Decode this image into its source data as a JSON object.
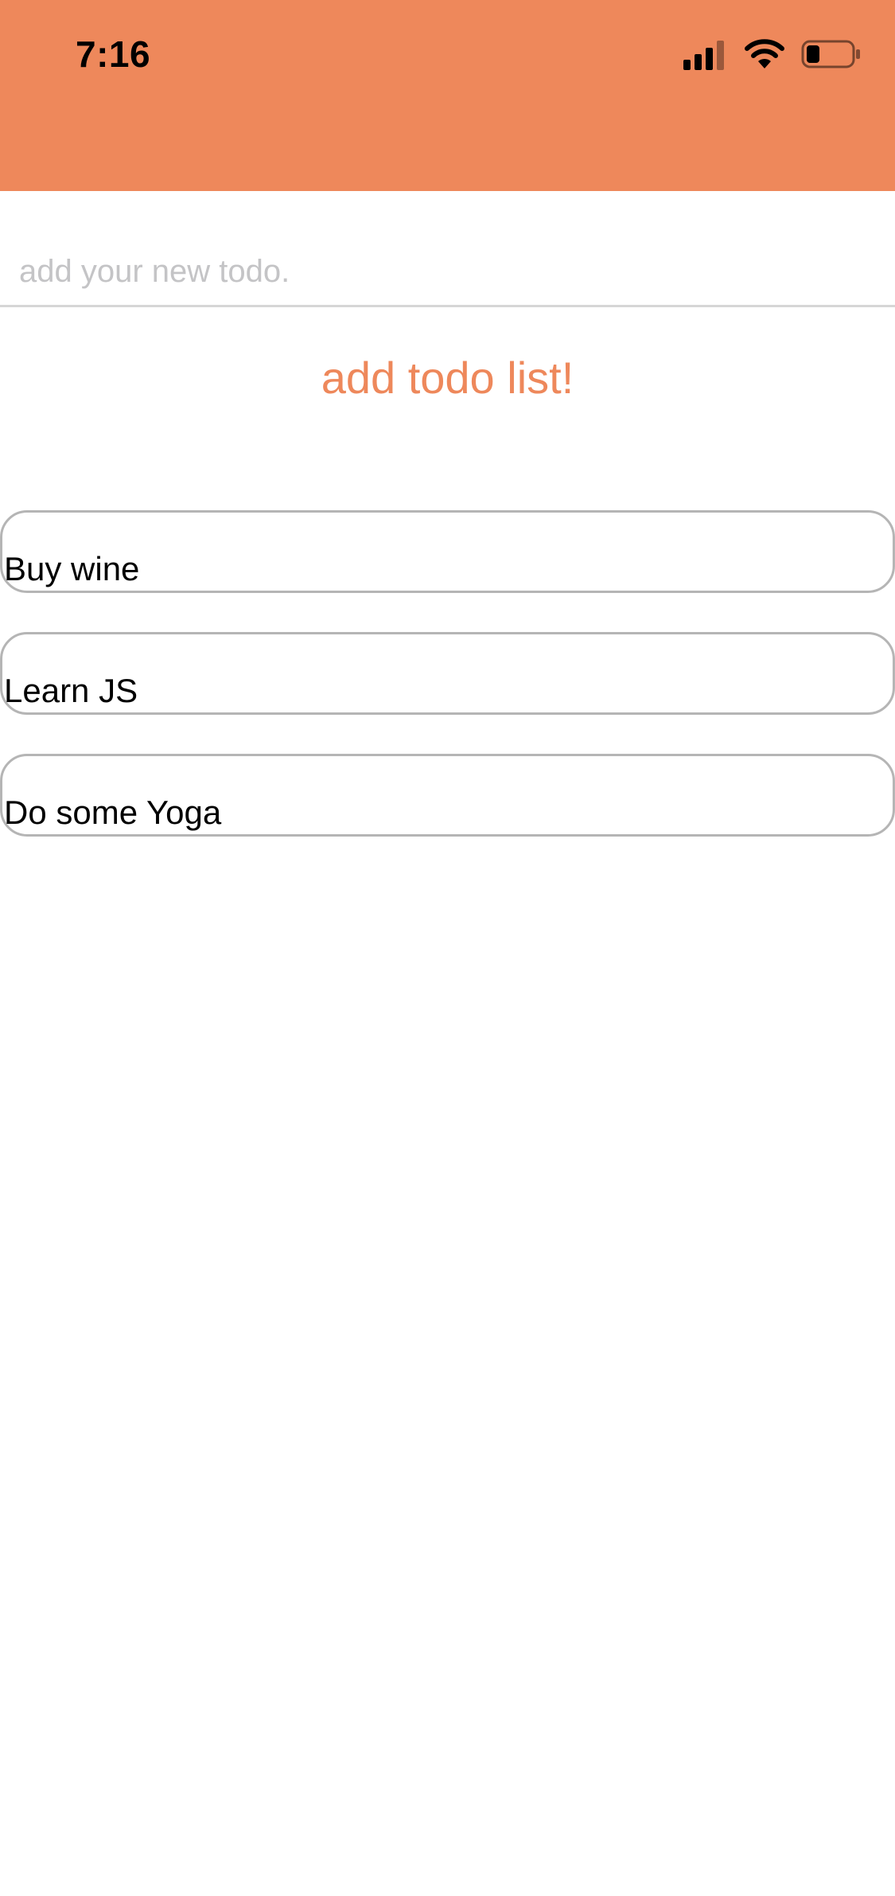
{
  "status_bar": {
    "time": "7:16",
    "icons": [
      "signal-icon",
      "wifi-icon",
      "battery-icon"
    ]
  },
  "colors": {
    "header_background": "#EE885B",
    "accent_text": "#EE885B",
    "item_border": "#B5B5B5",
    "input_placeholder": "#C4C4C6"
  },
  "input": {
    "placeholder": "add your new todo.",
    "value": ""
  },
  "add_button": {
    "label": "add todo list!"
  },
  "todos": [
    {
      "text": "Buy wine"
    },
    {
      "text": "Learn JS"
    },
    {
      "text": "Do some Yoga"
    }
  ]
}
